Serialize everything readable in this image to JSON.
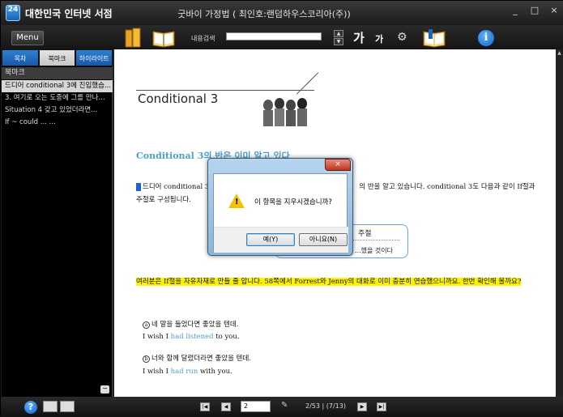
{
  "app": {
    "logo_text": "24",
    "title": "대한민국 인터넷 서점",
    "document_title": "굿바이 가정법 ( 최인호:랜덤하우스코리아(주))",
    "window_buttons": [
      "_",
      "□",
      "×"
    ]
  },
  "toolbar": {
    "menu_label": "Menu",
    "search_label": "내용검색",
    "search_value": "",
    "font_large": "가",
    "font_small": "가",
    "spinner_up": "▲",
    "spinner_down": "▼",
    "gear_glyph": "⚙",
    "info_glyph": "i",
    "icons": [
      "books-icon",
      "open-book-icon",
      "gear-icon",
      "bookmark-book-icon",
      "info-icon"
    ]
  },
  "sidebar": {
    "tabs": [
      {
        "label": "목차",
        "active": false
      },
      {
        "label": "북마크",
        "active": true
      },
      {
        "label": "하이라이트",
        "active": false
      }
    ],
    "header": "북마크",
    "items": [
      {
        "label": "드디어 conditional 3에 진입했습...",
        "selected": true
      },
      {
        "label": "3. 여기로 오는 도중에 그를 만나...",
        "selected": false
      },
      {
        "label": "Situation 4 갖고 있었더라면...",
        "selected": false
      },
      {
        "label": "If ~ could ... ...",
        "selected": false
      }
    ],
    "scroll_glyph": "−"
  },
  "content": {
    "chapter_title": "Conditional 3",
    "section_heading": "Conditional 3의 반은 이미 알고 있다",
    "para1_a": "드디어 conditional 3",
    "para1_b": "의 반을 알고 있습니다. conditional 3도 다음과 같이 If절과",
    "para1_c": "주절로 구성됩니다.",
    "callout_title": "주절",
    "callout_text": "...했을 것이다",
    "highlight_text": "여러분은 If절을 자유자재로 만들 줄 압니다. 58쪽에서 Forrest와 Jenny의 대화로 이미 충분히 연습했으니까요. 한번 확인해 볼까요?",
    "examples": [
      {
        "num": "a",
        "kor": "네 말을 들었다면 좋았을 텐데.",
        "eng_pre": "I wish I ",
        "eng_blue": "had listened",
        "eng_post": " to you."
      },
      {
        "num": "b",
        "kor": "너와 함께 달렸더라면 좋았을 텐데.",
        "eng_pre": "I wish I ",
        "eng_blue": "had run",
        "eng_post": " with you."
      }
    ]
  },
  "dialog": {
    "close_glyph": "×",
    "message": "이 항목을 지우시겠습니까?",
    "yes_label": "예(Y)",
    "no_label": "아니요(N)",
    "warn_mark": "!"
  },
  "statusbar": {
    "help_glyph": "?",
    "first_glyph": "|◀",
    "prev_glyph": "◀",
    "next_glyph": "▶",
    "last_glyph": "▶|",
    "pen_glyph": "✎",
    "page_value": "2",
    "page_info": "2/53 | (7/13)"
  },
  "colors": {
    "accent_tab": "#2f7fd3",
    "highlight": "#fff200",
    "heading_blue": "#4f9fcf"
  }
}
